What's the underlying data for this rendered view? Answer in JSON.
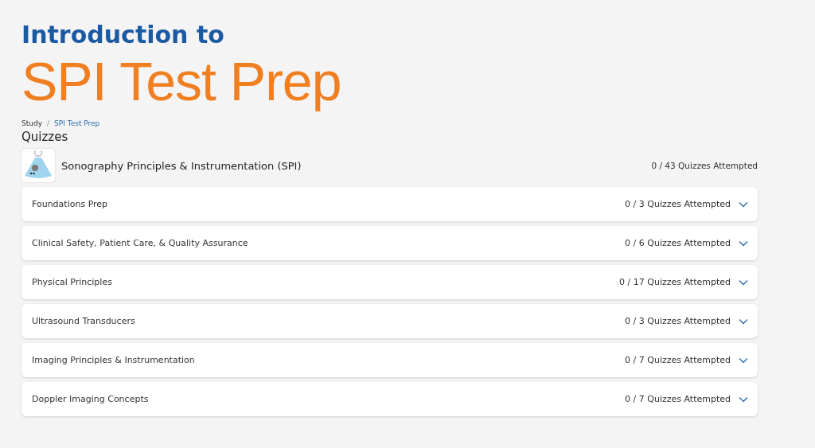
{
  "heading": {
    "subtitle": "Introduction to",
    "title": "SPI Test Prep"
  },
  "breadcrumb": [
    {
      "label": "Study",
      "kind": "text"
    },
    {
      "label": "/",
      "kind": "separator"
    },
    {
      "label": "SPI Test Prep",
      "kind": "link"
    }
  ],
  "section_title": "Quizzes",
  "course": {
    "name": "Sonography Principles & Instrumentation (SPI)",
    "progress": "0 / 43 Quizzes Attempted"
  },
  "topics": [
    {
      "name": "Foundations Prep",
      "progress": "0 / 3 Quizzes Attempted",
      "expanded": false
    },
    {
      "name": "Clinical Safety, Patient Care, & Quality Assurance",
      "progress": "0 / 6 Quizzes Attempted",
      "expanded": false
    },
    {
      "name": "Physical Principles",
      "progress": "0 / 17 Quizzes Attempted",
      "expanded": false
    },
    {
      "name": "Ultrasound Transducers",
      "progress": "0 / 3 Quizzes Attempted",
      "expanded": false
    },
    {
      "name": "Imaging Principles & Instrumentation",
      "progress": "0 / 7 Quizzes Attempted",
      "expanded": false
    },
    {
      "name": "Doppler Imaging Concepts",
      "progress": "0 / 7 Quizzes Attempted",
      "expanded": false
    }
  ]
}
